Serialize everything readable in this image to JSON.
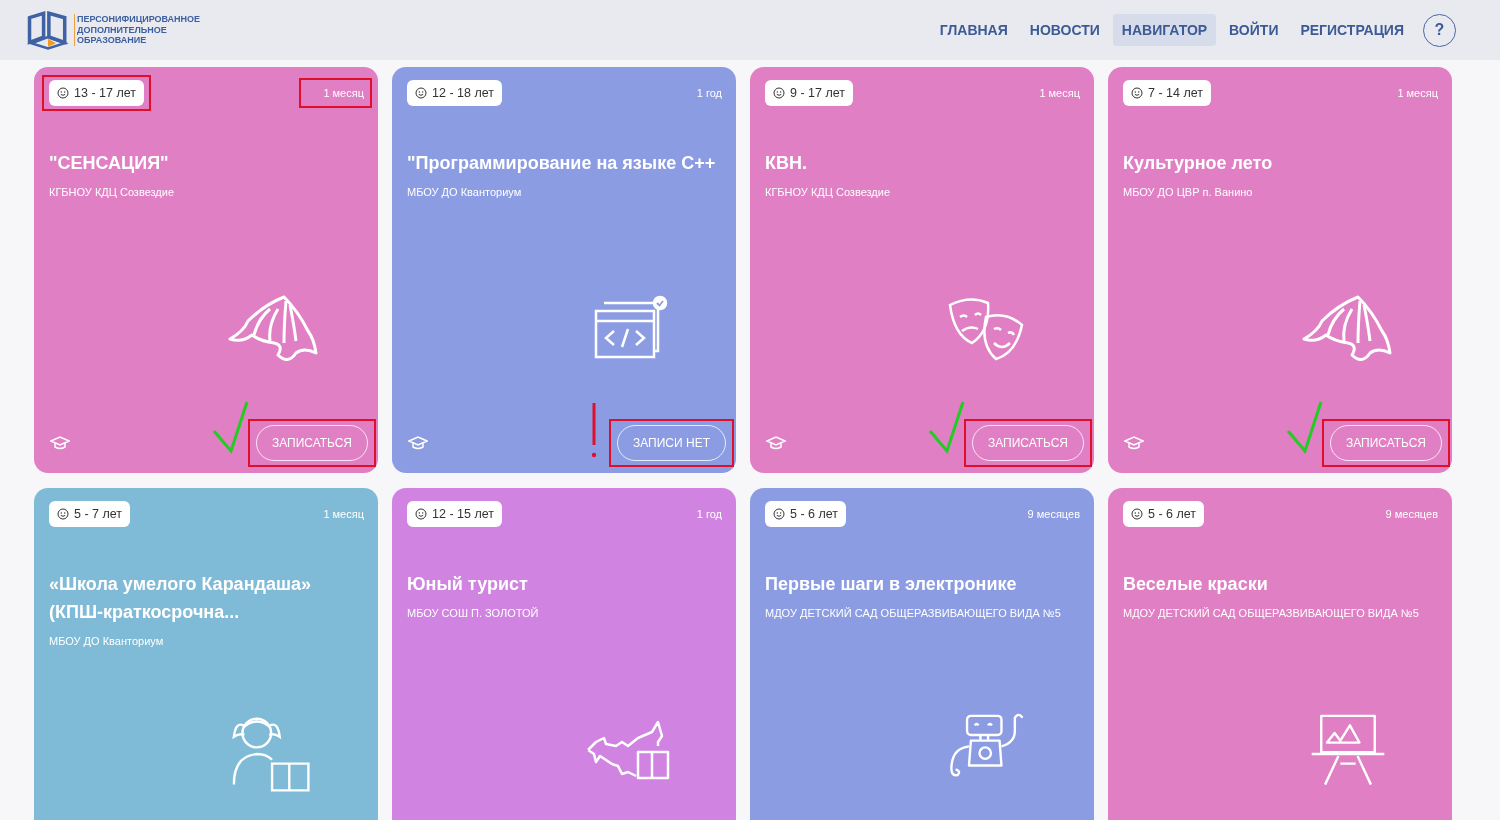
{
  "header": {
    "logo_lines": [
      "ПЕРСОНИФИЦИРОВАННОЕ",
      "ДОПОЛНИТЕЛЬНОЕ",
      "ОБРАЗОВАНИЕ"
    ],
    "nav": [
      {
        "label": "ГЛАВНАЯ",
        "selected": false
      },
      {
        "label": "НОВОСТИ",
        "selected": false
      },
      {
        "label": "НАВИГАТОР",
        "selected": true
      },
      {
        "label": "ВОЙТИ",
        "selected": false
      },
      {
        "label": "РЕГИСТРАЦИЯ",
        "selected": false
      }
    ],
    "help": "?"
  },
  "cards": [
    {
      "color": "#e07fc3",
      "age": "13 - 17 лет",
      "age_highlighted": true,
      "duration": "1 месяц",
      "duration_highlighted": true,
      "title": "\"СЕНСАЦИЯ\"",
      "org": "КГБНОУ КДЦ Созвездие",
      "footer": {
        "button": "ЗАПИСАТЬСЯ",
        "button_highlighted": true,
        "check_mark": true,
        "alert_mark": false
      }
    },
    {
      "color": "#8b9ce3",
      "age": "12 - 18 лет",
      "age_highlighted": false,
      "duration": "1 год",
      "duration_highlighted": false,
      "title": "\"Программирование на языке С++",
      "org": "МБОУ ДО Кванториум",
      "footer": {
        "button": "ЗАПИСИ НЕТ",
        "button_highlighted": true,
        "check_mark": false,
        "alert_mark": true
      }
    },
    {
      "color": "#e07fc3",
      "age": "9 - 17 лет",
      "age_highlighted": false,
      "duration": "1 месяц",
      "duration_highlighted": false,
      "title": "КВН.",
      "org": "КГБНОУ КДЦ Созвездие",
      "footer": {
        "button": "ЗАПИСАТЬСЯ",
        "button_highlighted": true,
        "check_mark": true,
        "alert_mark": false
      }
    },
    {
      "color": "#e07fc3",
      "age": "7 - 14 лет",
      "age_highlighted": false,
      "duration": "1 месяц",
      "duration_highlighted": false,
      "title": "Культурное лето",
      "org": "МБОУ ДО ЦВР п. Ванино",
      "footer": {
        "button": "ЗАПИСАТЬСЯ",
        "button_highlighted": true,
        "check_mark": true,
        "alert_mark": false
      }
    },
    {
      "color": "#7fbbd7",
      "age": "5 - 7 лет",
      "age_highlighted": false,
      "duration": "1 месяц",
      "duration_highlighted": false,
      "title": "«Школа умелого Карандаша» (КПШ-краткосрочна...",
      "org": "МБОУ ДО Кванториум"
    },
    {
      "color": "#d083e1",
      "age": "12 - 15 лет",
      "age_highlighted": false,
      "duration": "1 год",
      "duration_highlighted": false,
      "title": "Юный турист",
      "org": "МБОУ СОШ П. ЗОЛОТОЙ"
    },
    {
      "color": "#8b9ce3",
      "age": "5 - 6 лет",
      "age_highlighted": false,
      "duration": "9 месяцев",
      "duration_highlighted": false,
      "title": "Первые шаги в электронике",
      "org": "МДОУ ДЕТСКИЙ САД ОБЩЕРАЗВИВАЮЩЕГО ВИДА №5"
    },
    {
      "color": "#e07fc3",
      "age": "5 - 6 лет",
      "age_highlighted": false,
      "duration": "9 месяцев",
      "duration_highlighted": false,
      "title": "Веселые краски",
      "org": "МДОУ ДЕТСКИЙ САД ОБЩЕРАЗВИВАЮЩЕГО ВИДА №5"
    }
  ]
}
